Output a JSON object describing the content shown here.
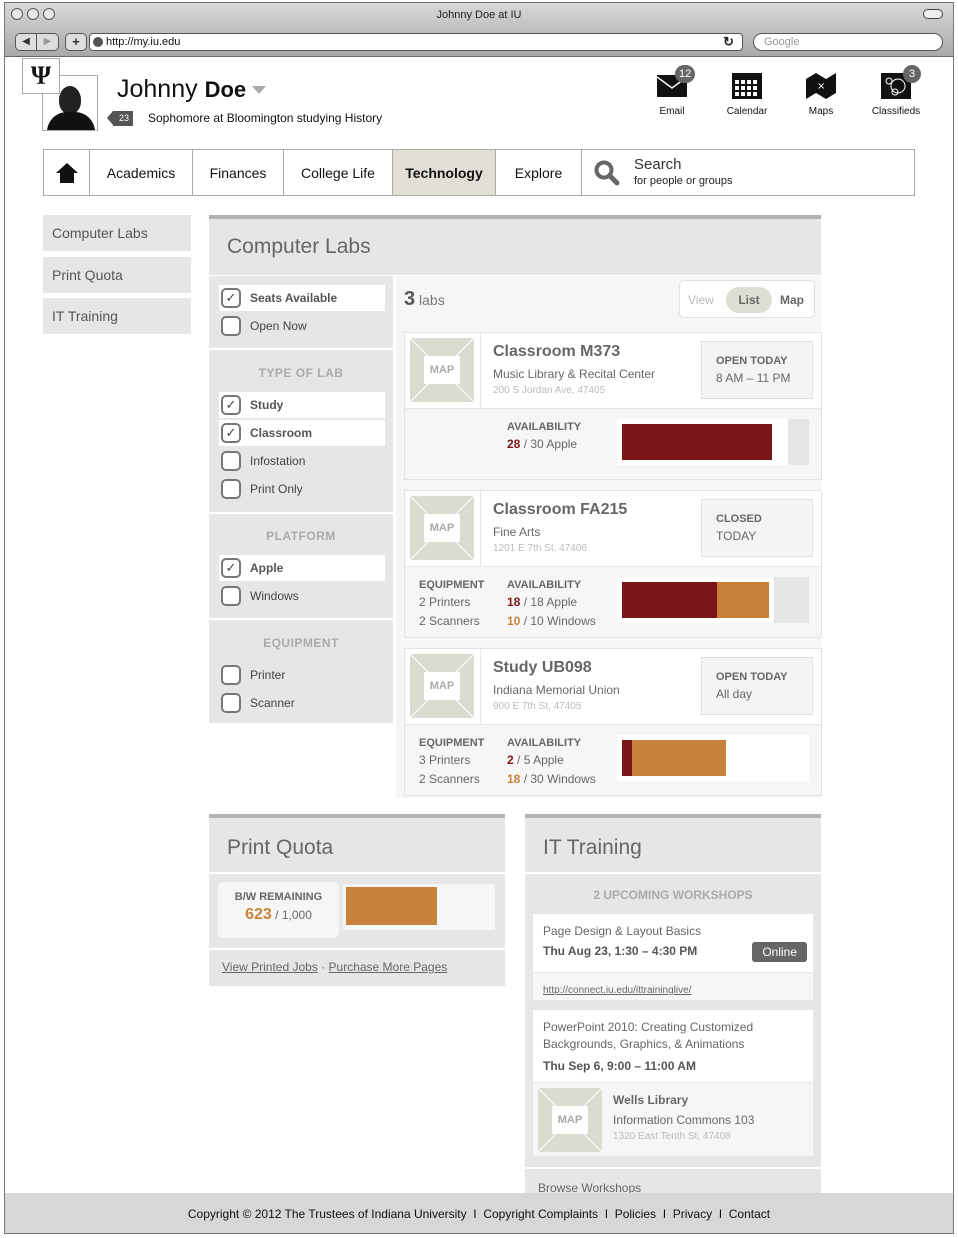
{
  "browser": {
    "title": "Johnny Doe at IU",
    "url": "http://my.iu.edu",
    "search_placeholder": "Google"
  },
  "user": {
    "first_name": "Johnny",
    "last_name": "Doe",
    "badge_count": "23",
    "subtitle": "Sophomore at Bloomington studying History"
  },
  "apps": [
    {
      "label": "Email",
      "icon": "envelope-icon",
      "badge": "12"
    },
    {
      "label": "Calendar",
      "icon": "calendar-icon",
      "badge": ""
    },
    {
      "label": "Maps",
      "icon": "map-icon",
      "badge": ""
    },
    {
      "label": "Classifieds",
      "icon": "classifieds-icon",
      "badge": "3"
    }
  ],
  "nav": {
    "home_icon": "home-icon",
    "items": [
      "Academics",
      "Finances",
      "College Life",
      "Technology",
      "Explore"
    ],
    "active": "Technology",
    "search_title": "Search",
    "search_sub": "for people or groups"
  },
  "sidebar": {
    "items": [
      "Computer Labs",
      "Print Quota",
      "IT Training"
    ]
  },
  "labs": {
    "title": "Computer Labs",
    "count": "3",
    "count_label": "labs",
    "view_label": "View",
    "view_list": "List",
    "view_map": "Map",
    "filters": {
      "top": [
        {
          "label": "Seats Available",
          "checked": true
        },
        {
          "label": "Open Now",
          "checked": false
        }
      ],
      "type_heading": "TYPE OF LAB",
      "type": [
        {
          "label": "Study",
          "checked": true
        },
        {
          "label": "Classroom",
          "checked": true
        },
        {
          "label": "Infostation",
          "checked": false
        },
        {
          "label": "Print Only",
          "checked": false
        }
      ],
      "platform_heading": "PLATFORM",
      "platform": [
        {
          "label": "Apple",
          "checked": true
        },
        {
          "label": "Windows",
          "checked": false
        }
      ],
      "equipment_heading": "EQUIPMENT",
      "equipment": [
        {
          "label": "Printer",
          "checked": false
        },
        {
          "label": "Scanner",
          "checked": false
        }
      ]
    },
    "map_label": "MAP",
    "equipment_heading": "EQUIPMENT",
    "availability_heading": "AVAILABILITY",
    "cards": [
      {
        "name": "Classroom M373",
        "building": "Music Library & Recital Center",
        "address": "200 S Jordan Ave, 47405",
        "status": "OPEN TODAY",
        "hours": "8 AM – 11 PM",
        "equipment": [],
        "apple": {
          "avail": "28",
          "total": "30",
          "label": "Apple"
        },
        "windows": null,
        "apple_fraction": 0.933,
        "windows_fraction": 0,
        "box_fraction": 0.89
      },
      {
        "name": "Classroom FA215",
        "building": "Fine Arts",
        "address": "1201 E 7th St, 47406",
        "status": "CLOSED",
        "hours": "TODAY",
        "equipment": [
          "2 Printers",
          "2 Scanners"
        ],
        "apple": {
          "avail": "18",
          "total": "18",
          "label": "Apple"
        },
        "windows": {
          "avail": "10",
          "total": "10",
          "label": "Windows"
        },
        "apple_fraction": 0.643,
        "windows_fraction": 0.357,
        "box_fraction": 0.82
      },
      {
        "name": "Study UB098",
        "building": "Indiana Memorial Union",
        "address": "900 E 7th St, 47405",
        "status": "OPEN TODAY",
        "hours": "All day",
        "equipment": [
          "3 Printers",
          "2 Scanners"
        ],
        "apple": {
          "avail": "2",
          "total": "5",
          "label": "Apple"
        },
        "windows": {
          "avail": "18",
          "total": "30",
          "label": "Windows"
        },
        "apple_fraction": 0.057,
        "windows_fraction": 0.514,
        "box_fraction": 1.0
      }
    ]
  },
  "print_quota": {
    "title": "Print Quota",
    "label": "B/W REMAINING",
    "remaining": "623",
    "total": "/ 1,000",
    "fraction": 0.623,
    "link1": "View Printed Jobs",
    "sep": "·",
    "link2": "Purchase More Pages"
  },
  "it_training": {
    "title": "IT Training",
    "upcoming": "2 UPCOMING WORKSHOPS",
    "w1": {
      "title": "Page Design & Layout Basics",
      "time": "Thu Aug 23, 1:30 – 4:30 PM",
      "badge": "Online",
      "link": "http://connect.iu.edu/ittraininglive/"
    },
    "w2": {
      "title": "PowerPoint 2010: Creating Customized Backgrounds, Graphics, & Animations",
      "time": "Thu Sep 6, 9:00 – 11:00 AM",
      "loc1": "Wells Library",
      "loc2": "Information Commons 103",
      "addr": "1320 East Tenth St, 47408"
    },
    "browse": "Browse Workshops"
  },
  "footer": {
    "copyright": "Copyright © 2012 The Trustees of Indiana University",
    "links": [
      "Copyright Complaints",
      "Policies",
      "Privacy",
      "Contact"
    ]
  },
  "colors": {
    "apple": "#7a1619",
    "windows": "#c8823c",
    "active_tab": "#e1dfd6"
  }
}
